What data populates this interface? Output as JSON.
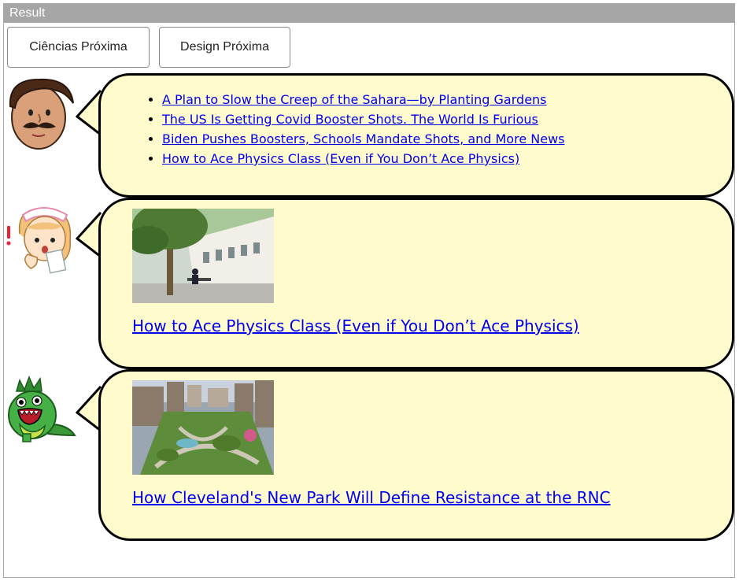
{
  "window": {
    "title": "Result"
  },
  "tabs": [
    {
      "label": "Ciências Próxima"
    },
    {
      "label": "Design Próxima"
    }
  ],
  "bubbles": [
    {
      "avatar": "mustache-man-avatar",
      "links": [
        "A Plan to Slow the Creep of the Sahara—by Planting Gardens",
        "The US Is Getting Covid Booster Shots. The World Is Furious",
        "Biden Pushes Boosters, Schools Mandate Shots, and More News",
        "How to Ace Physics Class (Even if You Don’t Ace Physics)"
      ]
    },
    {
      "avatar": "nurse-avatar",
      "image": "campus-courtyard-photo",
      "headline": "How to Ace Physics Class (Even if You Don’t Ace Physics)"
    },
    {
      "avatar": "green-dinosaur-avatar",
      "image": "city-park-aerial-photo",
      "headline": "How Cleveland's New Park Will Define Resistance at the RNC"
    }
  ],
  "colors": {
    "bubble_fill": "#fffbcc",
    "link": "#0000ee",
    "titlebar": "#a6a6a6"
  }
}
